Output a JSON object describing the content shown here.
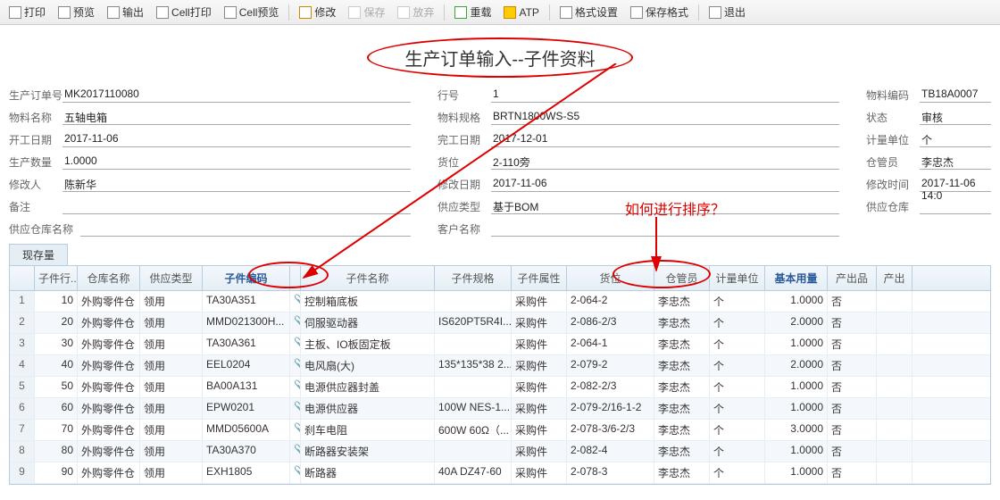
{
  "toolbar": {
    "print": "打印",
    "preview": "预览",
    "export": "输出",
    "cellPrint": "Cell打印",
    "cellPreview": "Cell预览",
    "modify": "修改",
    "save": "保存",
    "release": "放弃",
    "reload": "重载",
    "atp": "ATP",
    "format": "格式设置",
    "saveFormat": "保存格式",
    "exit": "退出"
  },
  "title": "生产订单输入--子件资料",
  "annotation": "如何进行排序？",
  "form": {
    "orderNo": {
      "label": "生产订单号",
      "value": "MK2017110080"
    },
    "line": {
      "label": "行号",
      "value": "1"
    },
    "matCode": {
      "label": "物料编码",
      "value": "TB18A0007"
    },
    "matName": {
      "label": "物料名称",
      "value": "五轴电箱"
    },
    "matSpec": {
      "label": "物料规格",
      "value": "BRTN1800WS-S5"
    },
    "status": {
      "label": "状态",
      "value": "审核"
    },
    "startDate": {
      "label": "开工日期",
      "value": "2017-11-06"
    },
    "endDate": {
      "label": "完工日期",
      "value": "2017-12-01"
    },
    "uom": {
      "label": "计量单位",
      "value": "个"
    },
    "qty": {
      "label": "生产数量",
      "value": "1.0000"
    },
    "loc": {
      "label": "货位",
      "value": "2-110旁"
    },
    "keeper": {
      "label": "仓管员",
      "value": "李忠杰"
    },
    "modifier": {
      "label": "修改人",
      "value": "陈新华"
    },
    "modifyDate": {
      "label": "修改日期",
      "value": "2017-11-06"
    },
    "modifyTime": {
      "label": "修改时间",
      "value": "2017-11-06 14:0"
    },
    "remark": {
      "label": "备注",
      "value": ""
    },
    "supplyType": {
      "label": "供应类型",
      "value": "基于BOM"
    },
    "supplyWh": {
      "label": "供应仓库",
      "value": ""
    },
    "supplyWhName": {
      "label": "供应仓库名称",
      "value": ""
    },
    "custName": {
      "label": "客户名称",
      "value": ""
    }
  },
  "tab": "现存量",
  "columns": [
    "",
    "子件行...",
    "仓库名称",
    "供应类型",
    "子件编码",
    "",
    "子件名称",
    "子件规格",
    "子件属性",
    "货位",
    "仓管员",
    "计量单位",
    "基本用量",
    "产出品",
    "产出"
  ],
  "boldCols": [
    4,
    12
  ],
  "rows": [
    {
      "n": "1",
      "line": "10",
      "wh": "外购零件仓",
      "st": "领用",
      "code": "TA30A351",
      "name": "控制箱底板",
      "spec": "",
      "attr": "采购件",
      "loc": "2-064-2",
      "kp": "李忠杰",
      "uom": "个",
      "qty": "1.0000",
      "out": "否"
    },
    {
      "n": "2",
      "line": "20",
      "wh": "外购零件仓",
      "st": "领用",
      "code": "MMD021300H...",
      "name": "伺服驱动器",
      "spec": "IS620PT5R4I...",
      "attr": "采购件",
      "loc": "2-086-2/3",
      "kp": "李忠杰",
      "uom": "个",
      "qty": "2.0000",
      "out": "否"
    },
    {
      "n": "3",
      "line": "30",
      "wh": "外购零件仓",
      "st": "领用",
      "code": "TA30A361",
      "name": "主板、IO板固定板",
      "spec": "",
      "attr": "采购件",
      "loc": "2-064-1",
      "kp": "李忠杰",
      "uom": "个",
      "qty": "1.0000",
      "out": "否"
    },
    {
      "n": "4",
      "line": "40",
      "wh": "外购零件仓",
      "st": "领用",
      "code": "EEL0204",
      "name": "电风扇(大)",
      "spec": "135*135*38 2...",
      "attr": "采购件",
      "loc": "2-079-2",
      "kp": "李忠杰",
      "uom": "个",
      "qty": "2.0000",
      "out": "否"
    },
    {
      "n": "5",
      "line": "50",
      "wh": "外购零件仓",
      "st": "领用",
      "code": "BA00A131",
      "name": "电源供应器封盖",
      "spec": "",
      "attr": "采购件",
      "loc": "2-082-2/3",
      "kp": "李忠杰",
      "uom": "个",
      "qty": "1.0000",
      "out": "否"
    },
    {
      "n": "6",
      "line": "60",
      "wh": "外购零件仓",
      "st": "领用",
      "code": "EPW0201",
      "name": "电源供应器",
      "spec": "100W NES-1...",
      "attr": "采购件",
      "loc": "2-079-2/16-1-2",
      "kp": "李忠杰",
      "uom": "个",
      "qty": "1.0000",
      "out": "否"
    },
    {
      "n": "7",
      "line": "70",
      "wh": "外购零件仓",
      "st": "领用",
      "code": "MMD05600A",
      "name": "刹车电阻",
      "spec": "600W 60Ω（...",
      "attr": "采购件",
      "loc": "2-078-3/6-2/3",
      "kp": "李忠杰",
      "uom": "个",
      "qty": "3.0000",
      "out": "否"
    },
    {
      "n": "8",
      "line": "80",
      "wh": "外购零件仓",
      "st": "领用",
      "code": "TA30A370",
      "name": "断路器安装架",
      "spec": "",
      "attr": "采购件",
      "loc": "2-082-4",
      "kp": "李忠杰",
      "uom": "个",
      "qty": "1.0000",
      "out": "否"
    },
    {
      "n": "9",
      "line": "90",
      "wh": "外购零件仓",
      "st": "领用",
      "code": "EXH1805",
      "name": "断路器",
      "spec": "40A DZ47-60",
      "attr": "采购件",
      "loc": "2-078-3",
      "kp": "李忠杰",
      "uom": "个",
      "qty": "1.0000",
      "out": "否"
    }
  ]
}
